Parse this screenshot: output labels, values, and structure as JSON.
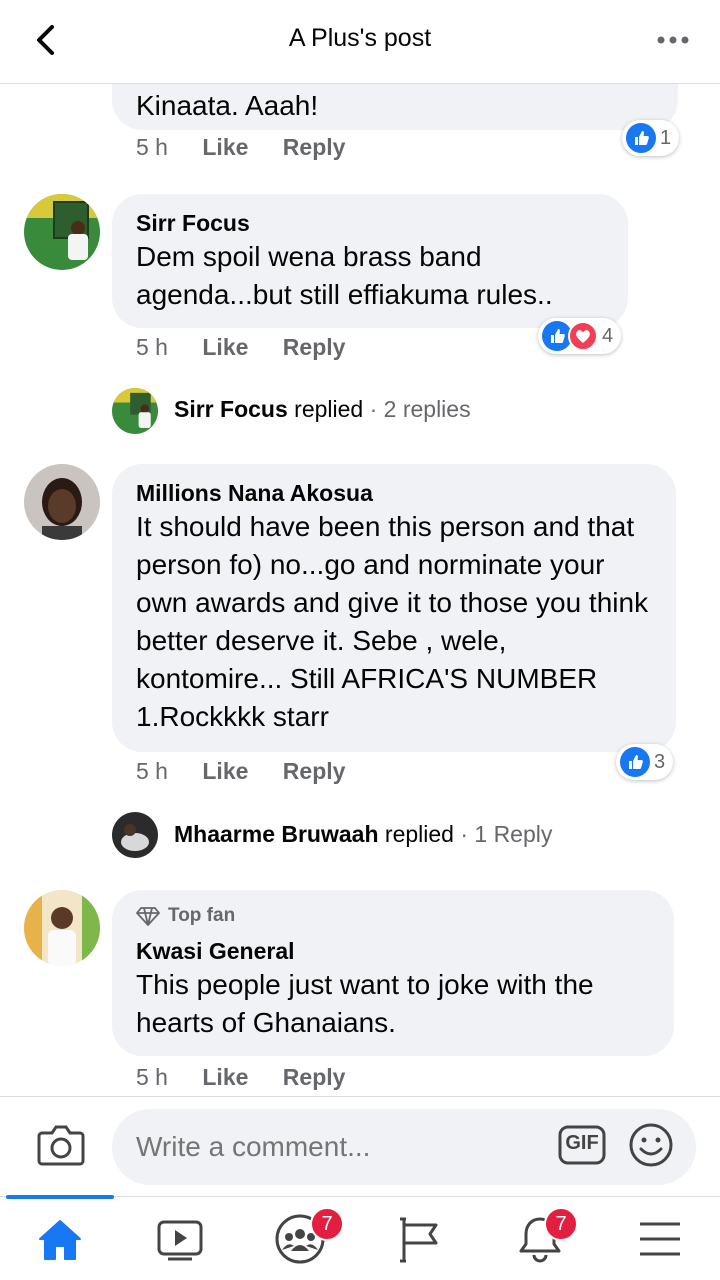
{
  "header": {
    "title": "A Plus's post",
    "back_icon": "chevron-left-icon",
    "more_icon": "more-horizontal-icon"
  },
  "comments": [
    {
      "text": "Kinaata. Aaah!",
      "time": "5 h",
      "like": "Like",
      "reply": "Reply",
      "reaction_count": "1",
      "reactions": [
        "like"
      ]
    },
    {
      "author": "Sirr Focus",
      "text": "Dem spoil wena brass band agenda...but still effiakuma rules..",
      "time": "5 h",
      "like": "Like",
      "reply": "Reply",
      "reaction_count": "4",
      "reactions": [
        "like",
        "love"
      ],
      "replies": {
        "name": "Sirr Focus",
        "verb": " replied",
        "count": " · 2 replies"
      }
    },
    {
      "author": "Millions Nana Akosua",
      "text": "It should have been this person and that person fo) no...go and norminate your own awards and give it to those you think better deserve it. Sebe , wele, kontomire... Still AFRICA'S NUMBER 1.Rockkkk starr",
      "time": "5 h",
      "like": "Like",
      "reply": "Reply",
      "reaction_count": "3",
      "reactions": [
        "like"
      ],
      "replies": {
        "name": "Mhaarme Bruwaah",
        "verb": " replied",
        "count": " · 1 Reply"
      }
    },
    {
      "badge": "Top fan",
      "author": "Kwasi General",
      "text": "This people just want to joke with the hearts of Ghanaians.",
      "time": "5 h",
      "like": "Like",
      "reply": "Reply"
    }
  ],
  "composer": {
    "placeholder": "Write a comment...",
    "camera_icon": "camera-icon",
    "gif_label": "GIF",
    "emoji_icon": "smiley-icon"
  },
  "nav": {
    "items": [
      {
        "icon": "home-icon",
        "active": true
      },
      {
        "icon": "video-icon"
      },
      {
        "icon": "groups-icon",
        "badge": "7"
      },
      {
        "icon": "pages-flag-icon"
      },
      {
        "icon": "bell-icon",
        "badge": "7"
      },
      {
        "icon": "menu-icon"
      }
    ]
  },
  "colors": {
    "accent": "#1877f2",
    "bubble": "#f0f2f5",
    "badge": "#e41e3f",
    "love": "#f33e58",
    "muted": "#65676b"
  }
}
